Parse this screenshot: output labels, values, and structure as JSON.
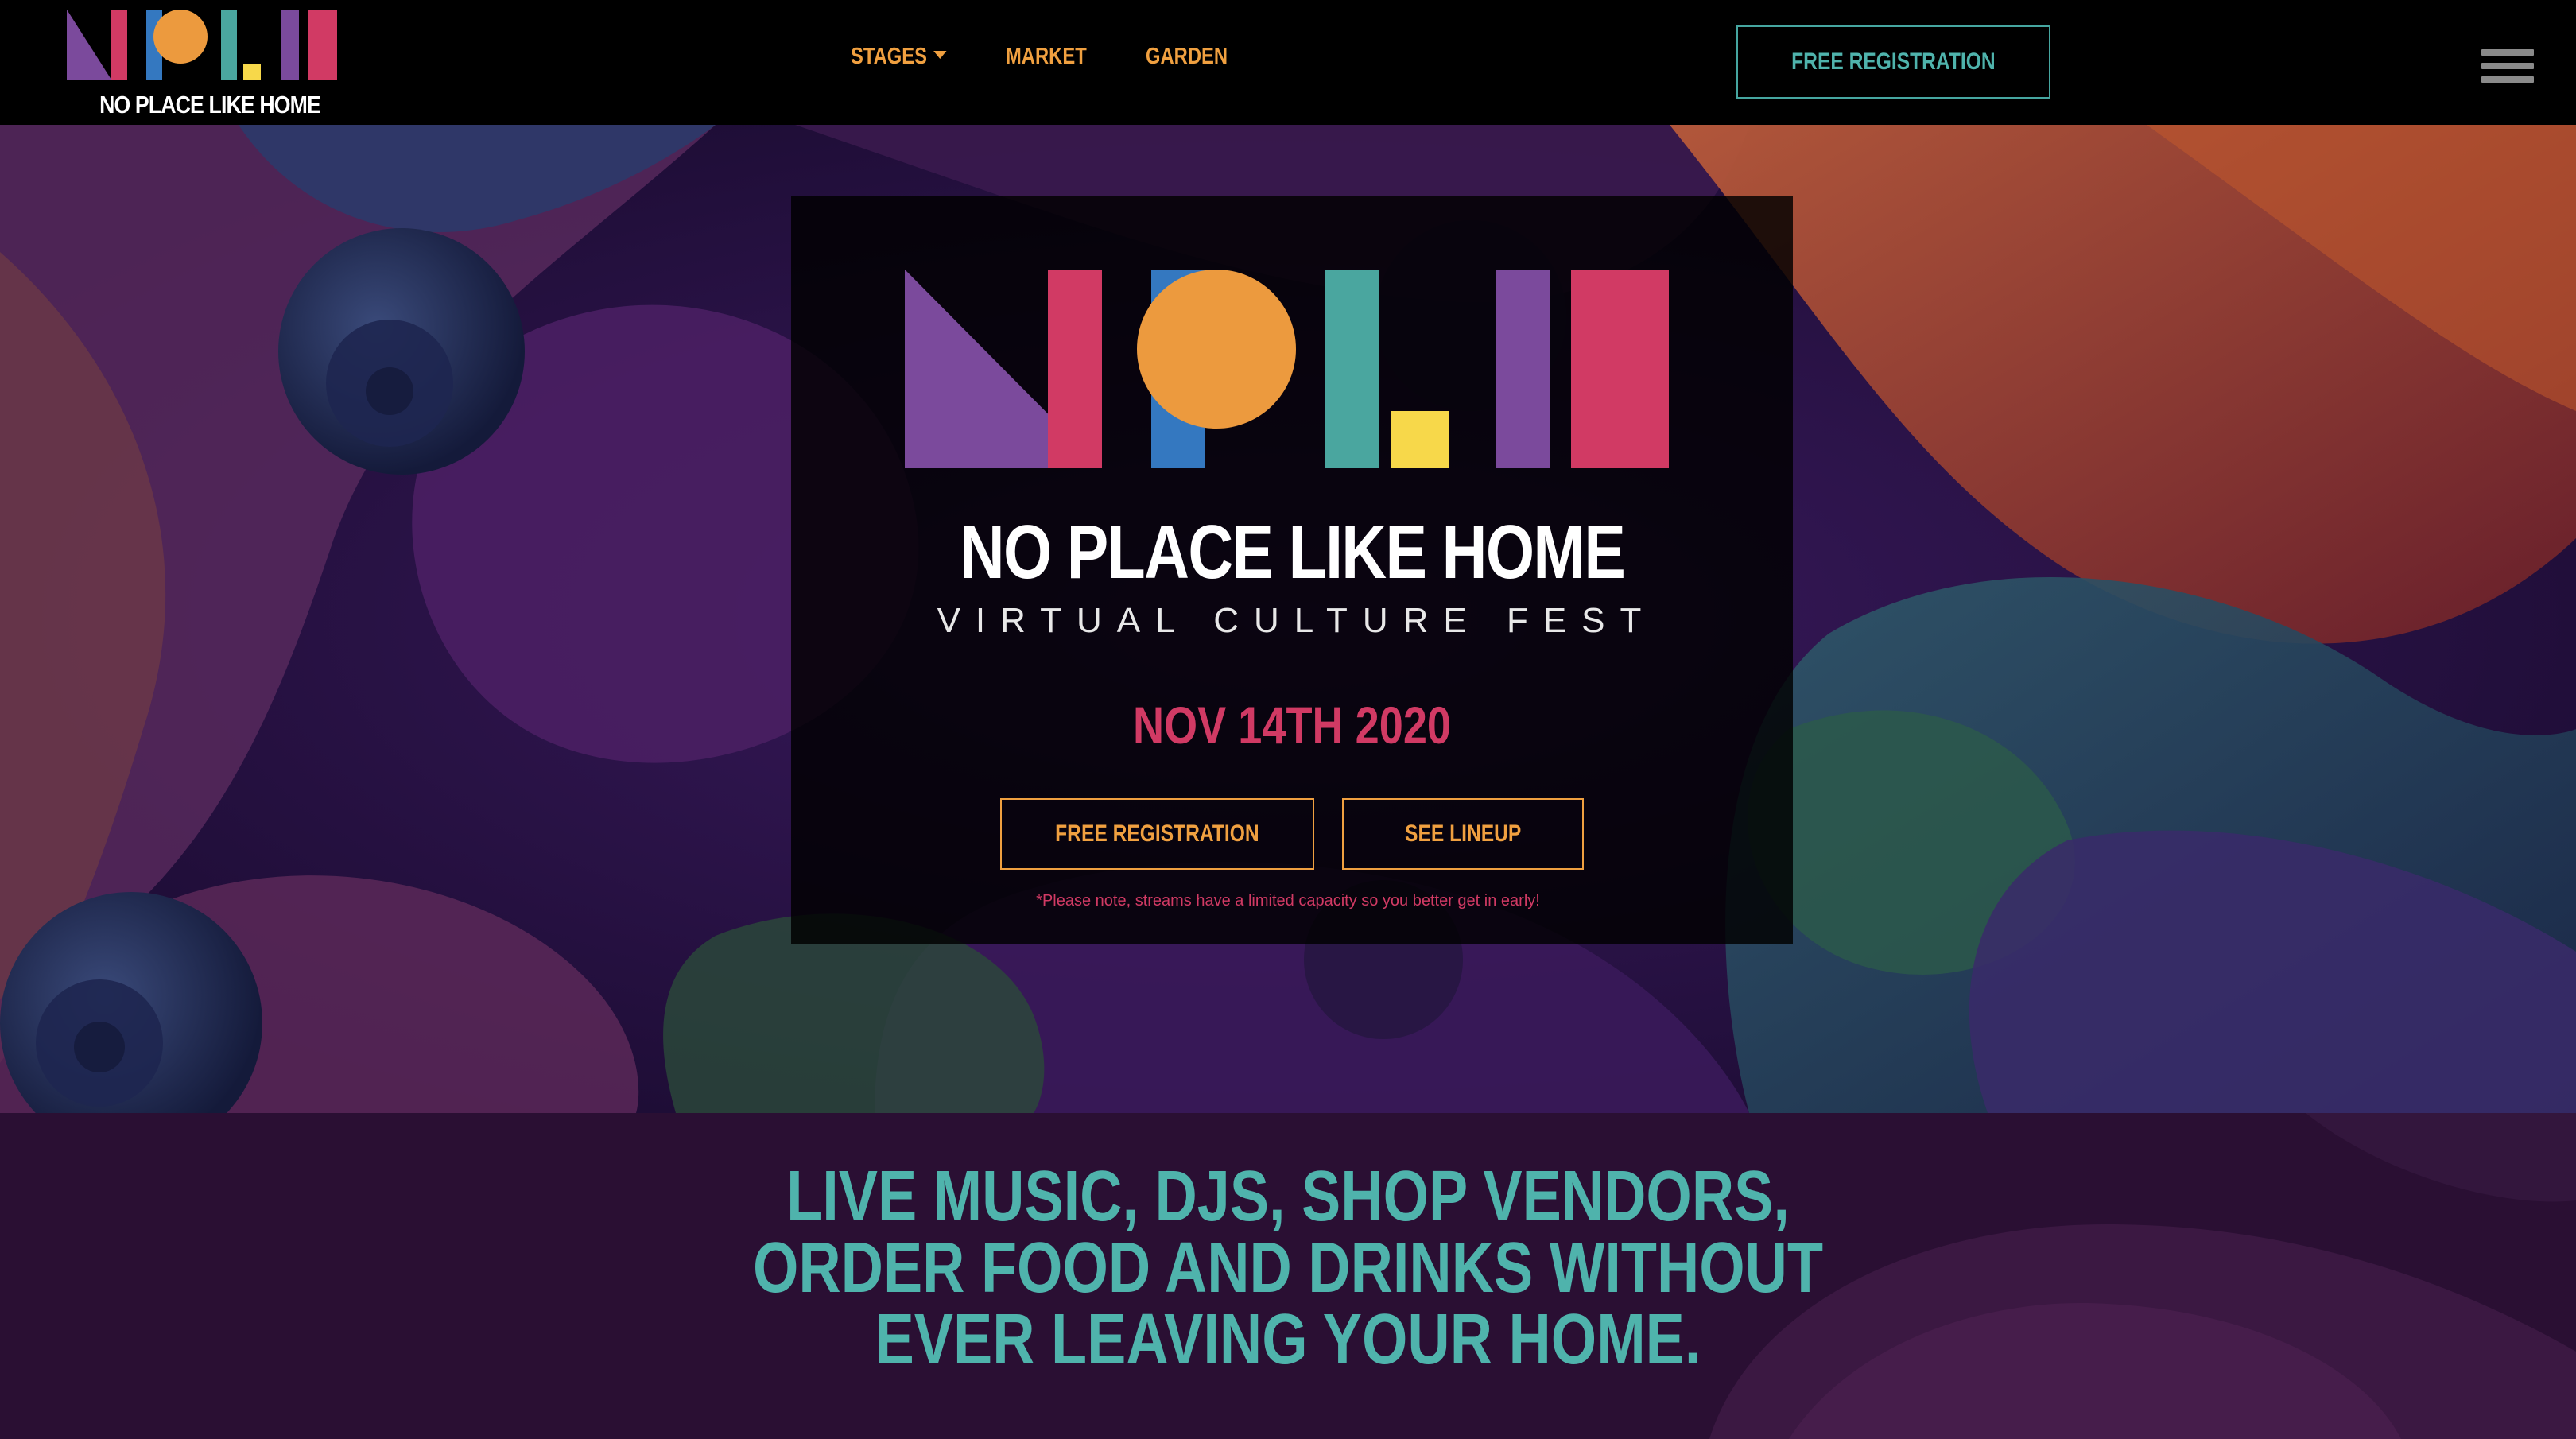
{
  "brand": {
    "name": "NO PLACE LIKE HOME",
    "logo_icon": "nplh-geometric-logo"
  },
  "nav": {
    "items": [
      {
        "label": "STAGES",
        "has_dropdown": true
      },
      {
        "label": "MARKET"
      },
      {
        "label": "GARDEN"
      }
    ],
    "register_label": "FREE REGISTRATION",
    "menu_icon": "hamburger-menu-icon"
  },
  "hero": {
    "title": "NO PLACE LIKE HOME",
    "subtitle": "VIRTUAL CULTURE FEST",
    "date": "NOV 14TH 2020",
    "register_label": "FREE REGISTRATION",
    "lineup_label": "SEE LINEUP",
    "note": "*Please note, streams have a limited capacity so you better get in early!"
  },
  "tagline": {
    "lines": [
      "LIVE MUSIC, DJS, SHOP VENDORS,",
      "ORDER FOOD AND DRINKS WITHOUT",
      "EVER LEAVING YOUR HOME."
    ]
  },
  "colors": {
    "purple": "#7b4a9c",
    "pink": "#d13a64",
    "blue": "#3478c0",
    "orange": "#ec9a3e",
    "teal": "#4aa69f",
    "yellow": "#f7d84a",
    "nav_link": "#f0a040",
    "tagline": "#4fb3ac"
  }
}
